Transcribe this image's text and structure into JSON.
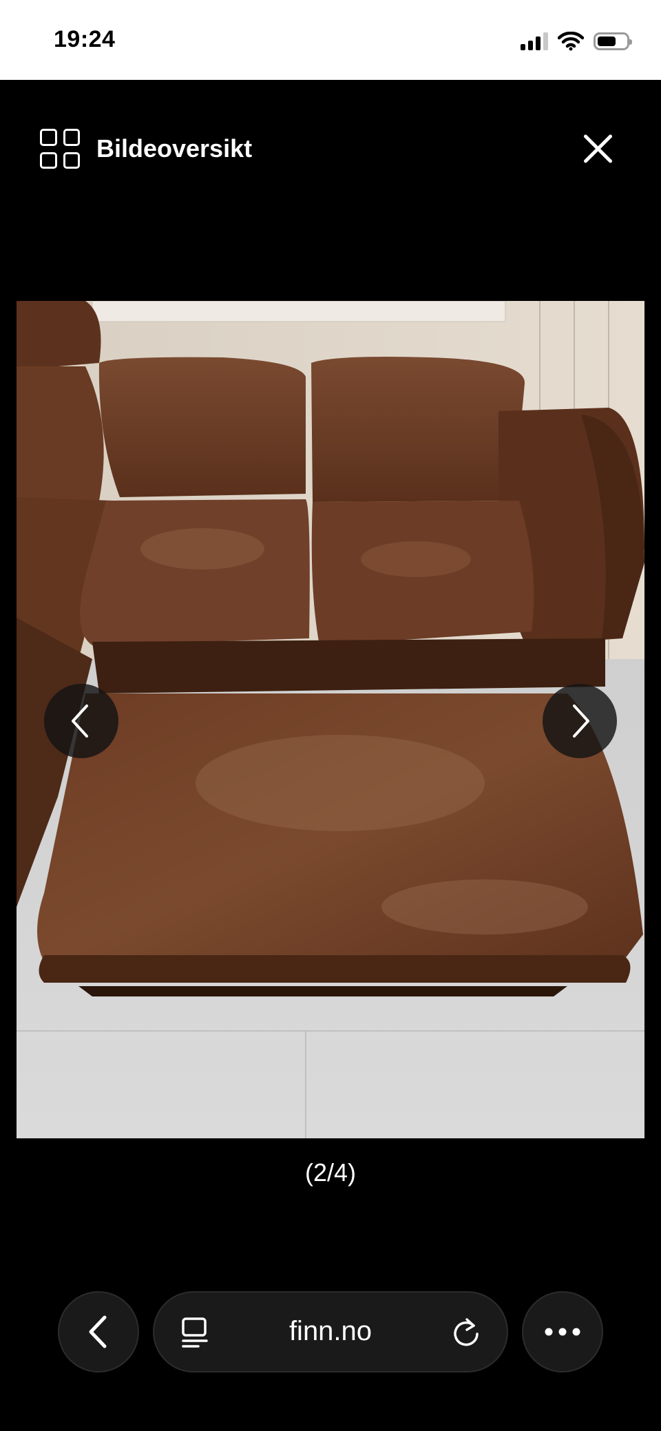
{
  "status_bar": {
    "time": "19:24",
    "icons": [
      "cellular-signal-icon",
      "wifi-icon",
      "battery-icon"
    ]
  },
  "viewer": {
    "overview_label": "Bildeoversikt",
    "overview_icon": "grid-icon",
    "close_icon": "close-icon",
    "prev_icon": "chevron-left-icon",
    "next_icon": "chevron-right-icon",
    "counter": "(2/4)",
    "image_index": 2,
    "image_total": 4
  },
  "toolbar": {
    "back_icon": "chevron-left-icon",
    "reader_icon": "reader-mode-icon",
    "url": "finn.no",
    "reload_icon": "reload-icon",
    "more_icon": "more-icon"
  },
  "colors": {
    "background": "#000000",
    "status_bar": "#ffffff",
    "toolbar_button": "#1a1a1a",
    "leather": "#6b3a22"
  }
}
